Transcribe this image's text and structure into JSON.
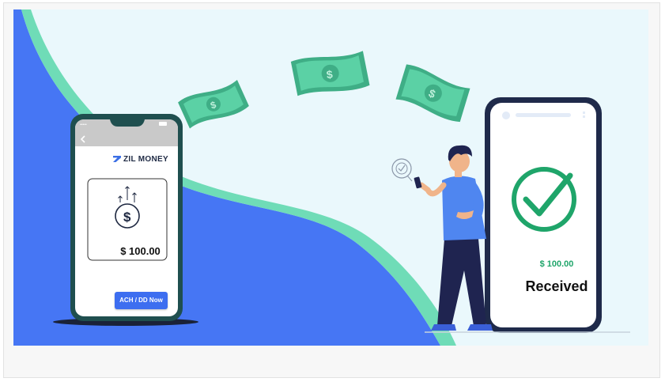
{
  "left_phone": {
    "brand_name": "ZIL MONEY",
    "amount": "$ 100.00",
    "button_label": "ACH / DD Now"
  },
  "right_phone": {
    "amount": "$ 100.00",
    "status_label": "Received"
  },
  "icons": [
    "back-chevron-icon",
    "dollar-coin-icon",
    "upward-arrows-icon",
    "checkmark-circle-icon",
    "banknote-icon",
    "person-with-phone-illustration"
  ],
  "colors": {
    "accent_blue": "#3d6ef0",
    "success_green": "#1fa56a",
    "banknote_green": "#4fc39b",
    "background": "#eaf8fc"
  }
}
